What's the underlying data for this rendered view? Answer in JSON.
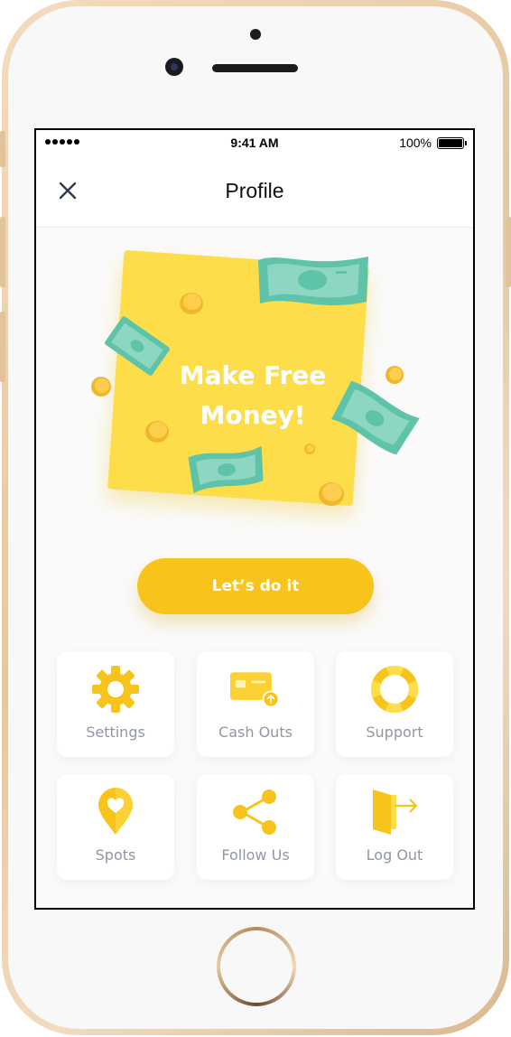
{
  "status_bar": {
    "time": "9:41 AM",
    "battery": "100%"
  },
  "nav": {
    "title": "Profile",
    "close_icon": "close-icon"
  },
  "promo": {
    "line1": "Make Free",
    "line2": "Money!"
  },
  "cta": {
    "label": "Let’s do it"
  },
  "menu": [
    {
      "label": "Settings",
      "icon": "gear-icon"
    },
    {
      "label": "Cash Outs",
      "icon": "credit-card-icon"
    },
    {
      "label": "Support",
      "icon": "lifebuoy-icon"
    },
    {
      "label": "Spots",
      "icon": "map-pin-heart-icon"
    },
    {
      "label": "Follow Us",
      "icon": "share-icon"
    },
    {
      "label": "Log Out",
      "icon": "logout-door-icon"
    }
  ],
  "colors": {
    "accent_yellow": "#f8c41c",
    "card_yellow": "#fedd4b",
    "bill_green": "#8dd6c2",
    "label_gray": "#9097a4",
    "phone_gold": "#e6c79f"
  }
}
